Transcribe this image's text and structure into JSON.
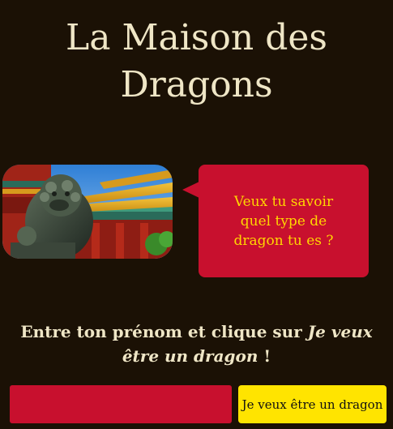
{
  "header": {
    "title": "La Maison des Dragons"
  },
  "photo": {
    "alt": "Statue de lion gardien devant un temple chinois"
  },
  "bubble": {
    "text": "Veux tu savoir quel type de dragon tu es ?"
  },
  "instruction": {
    "prefix": "Entre ton prénom et clique sur ",
    "emphasis": "Je veux être un dragon",
    "suffix": " !"
  },
  "form": {
    "name_value": "",
    "name_placeholder": "",
    "button_label": "Je veux être un dragon"
  },
  "colors": {
    "background": "#1b1105",
    "accent_red": "#c8102e",
    "accent_yellow": "#ffe400",
    "text_cream": "#efe6c6",
    "bubble_text": "#ffd700"
  }
}
